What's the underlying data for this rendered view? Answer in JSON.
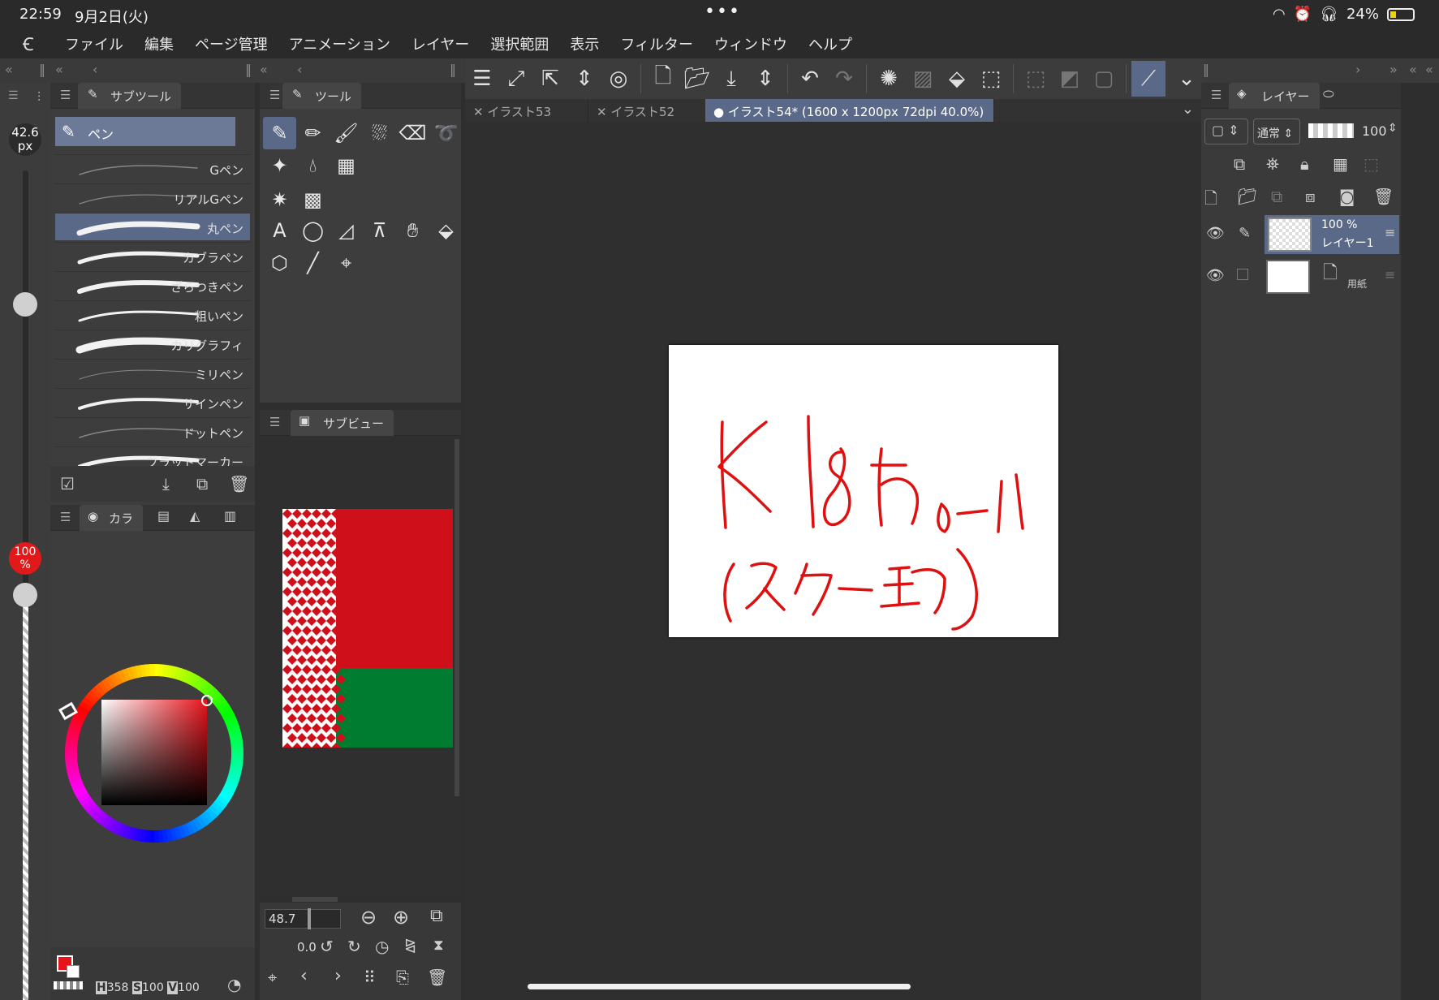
{
  "status_bar": {
    "time": "22:59",
    "date": "9月2日(火)",
    "battery": "24%"
  },
  "menu": {
    "items": [
      "ファイル",
      "編集",
      "ページ管理",
      "アニメーション",
      "レイヤー",
      "選択範囲",
      "表示",
      "フィルター",
      "ウィンドウ",
      "ヘルプ"
    ]
  },
  "brush_size": {
    "value": "42.6",
    "unit": "px"
  },
  "opacity": {
    "value": "100",
    "unit": "%"
  },
  "subtool_panel": {
    "tab_label": "サブツール",
    "group_label": "ペン",
    "brushes": [
      {
        "name": "Gペン",
        "selected": false
      },
      {
        "name": "リアルGペン",
        "selected": false
      },
      {
        "name": "丸ペン",
        "selected": true
      },
      {
        "name": "カブラペン",
        "selected": false
      },
      {
        "name": "ざらつきペン",
        "selected": false
      },
      {
        "name": "粗いペン",
        "selected": false
      },
      {
        "name": "カリグラフィ",
        "selected": false
      },
      {
        "name": "ミリペン",
        "selected": false
      },
      {
        "name": "サインペン",
        "selected": false
      },
      {
        "name": "ドットペン",
        "selected": false
      },
      {
        "name": "フラットマーカー",
        "selected": false
      }
    ]
  },
  "tool_panel": {
    "tab_label": "ツール"
  },
  "color_panel": {
    "tab_label": "カラ",
    "readout": {
      "h_label": "H",
      "h": "358",
      "s_label": "S",
      "s": "100",
      "v_label": "V",
      "v": "100"
    },
    "main_color": "#e8141c",
    "sub_color": "#ffffff"
  },
  "subview_panel": {
    "tab_label": "サブビュー",
    "zoom": "48.7",
    "rotation": "0.0",
    "flag_colors": {
      "red": "#cf101a",
      "green": "#007c30",
      "white": "#ffffff"
    }
  },
  "document_tabs": [
    {
      "label": "イラスト53",
      "active": false
    },
    {
      "label": "イラスト52",
      "active": false
    },
    {
      "label": "イラスト54* (1600 x 1200px 72dpi 40.0%)",
      "active": true
    }
  ],
  "layer_panel": {
    "tab_label": "レイヤー",
    "blend_mode": "通常",
    "opacity": "100",
    "layers": [
      {
        "opacity": "100 %",
        "name": "レイヤー1",
        "selected": true
      },
      {
        "opacity": "",
        "name": "用紙",
        "selected": false
      }
    ]
  },
  "canvas": {
    "drawing_color": "#e01010"
  }
}
